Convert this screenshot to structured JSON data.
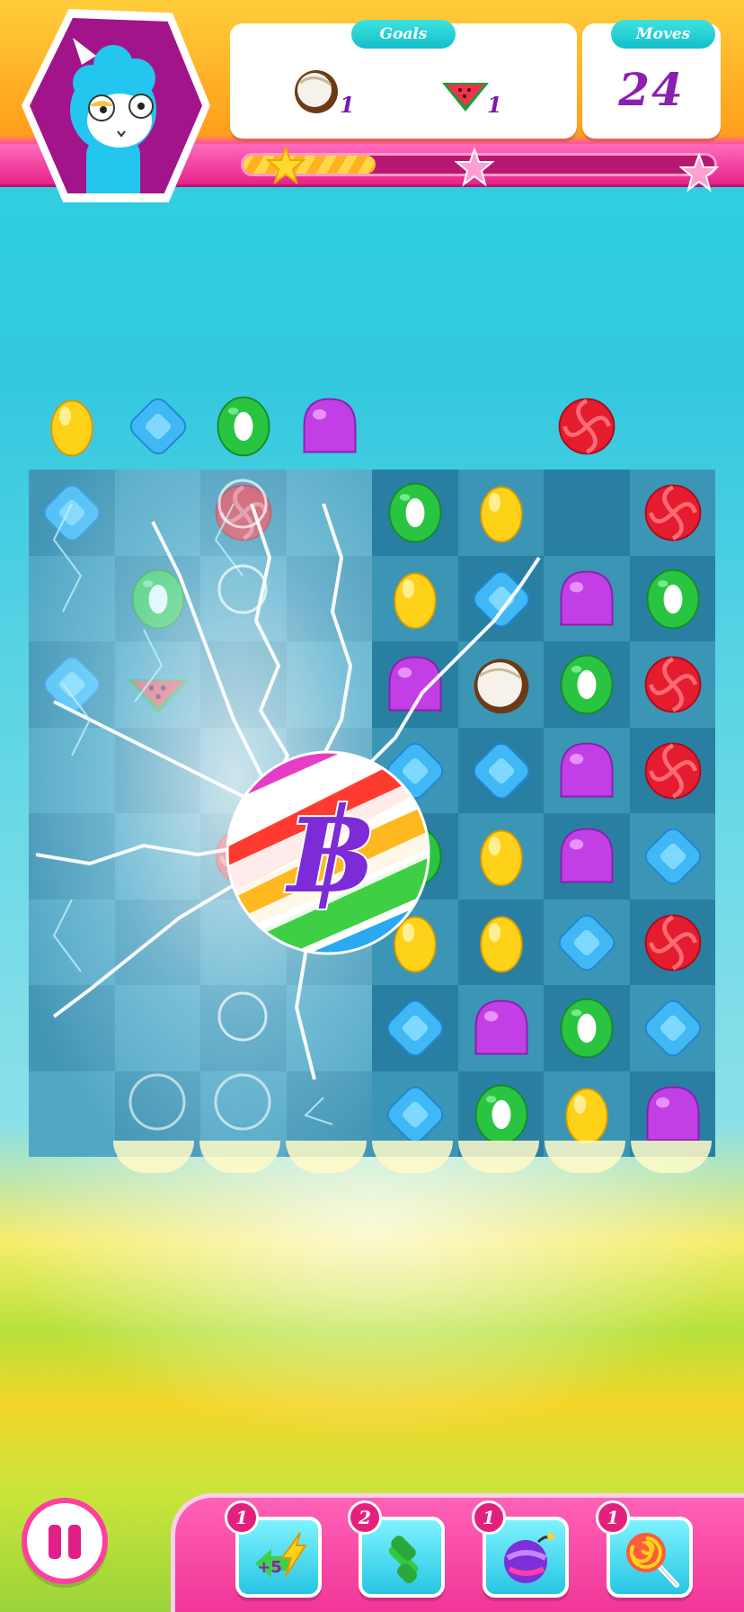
{
  "hud": {
    "goals_label": "Goals",
    "moves_label": "Moves",
    "moves_value": "24",
    "goals": [
      {
        "icon": "coconut-icon",
        "count": "1"
      },
      {
        "icon": "watermelon-icon",
        "count": "1"
      }
    ],
    "progress": 0.28,
    "stars_earned": 1,
    "stars_total": 3
  },
  "board": {
    "rows": 8,
    "cols": 8,
    "drop_row": [
      "yellow",
      "blue",
      "green",
      "purple",
      "",
      "",
      "red",
      ""
    ],
    "grid": [
      [
        "blue",
        "",
        "red",
        "",
        "green",
        "yellow",
        "",
        "red"
      ],
      [
        "",
        "green",
        "",
        "",
        "yellow",
        "blue",
        "purple",
        "green"
      ],
      [
        "blue",
        "watermelon",
        "",
        "",
        "purple",
        "coconut",
        "green",
        "red"
      ],
      [
        "",
        "",
        "",
        "",
        "blue",
        "blue",
        "purple",
        "red"
      ],
      [
        "",
        "",
        "red",
        "",
        "green",
        "yellow",
        "purple",
        "blue"
      ],
      [
        "",
        "",
        "",
        "",
        "yellow",
        "yellow",
        "blue",
        "red"
      ],
      [
        "",
        "",
        "",
        "",
        "blue",
        "purple",
        "green",
        "blue"
      ],
      [
        "",
        "",
        "",
        "",
        "blue",
        "green",
        "yellow",
        "purple"
      ]
    ],
    "color_bomb_glyph": "฿"
  },
  "boosters": [
    {
      "name": "extra-moves",
      "count": "1",
      "label": "+5"
    },
    {
      "name": "hammer",
      "count": "2"
    },
    {
      "name": "bomb",
      "count": "1"
    },
    {
      "name": "lollipop",
      "count": "1"
    }
  ],
  "colors": {
    "yellow": "#ffd21a",
    "blue": "#3fb8f5",
    "green": "#29c541",
    "purple": "#c23fe6",
    "red": "#e51b2e",
    "accent_pink": "#ff3f9e",
    "accent_teal": "#13bfc9"
  }
}
